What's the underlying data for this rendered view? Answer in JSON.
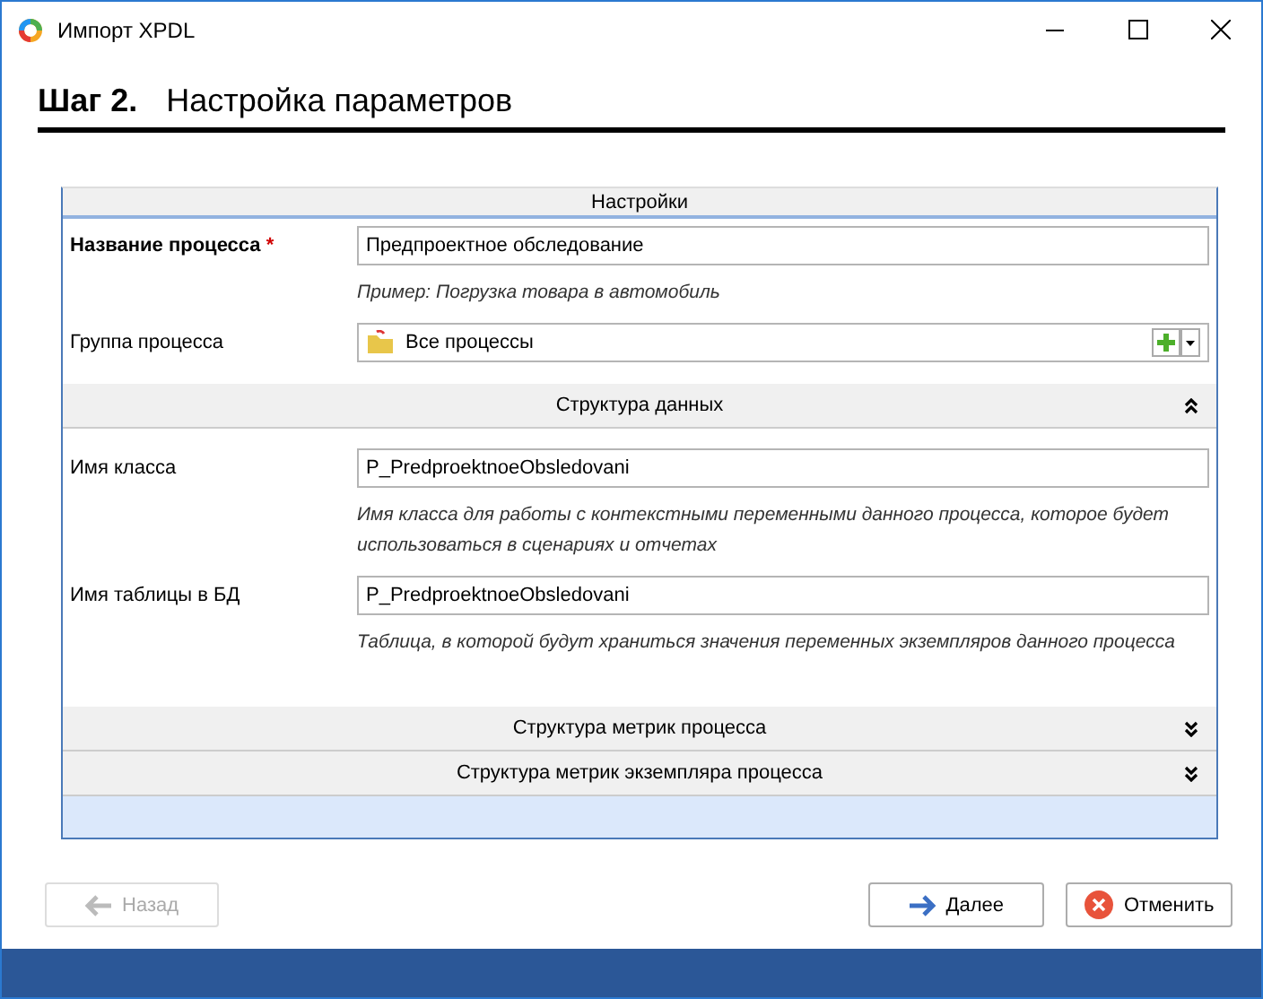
{
  "window": {
    "title": "Импорт XPDL"
  },
  "step": {
    "number": "Шаг 2.",
    "title": "Настройка параметров"
  },
  "panel": {
    "title": "Настройки",
    "fields": [
      {
        "kind": "text",
        "label": "Название процесса",
        "required": true,
        "required_mark": "*",
        "value": "Предпроектное обследование",
        "hint": "Пример: Погрузка товара в автомобиль"
      },
      {
        "kind": "combo",
        "label": "Группа процесса",
        "required": false,
        "value": "Все процессы"
      }
    ],
    "sections": [
      {
        "title": "Структура данных",
        "expanded": true,
        "fields": [
          {
            "kind": "text",
            "label": "Имя класса",
            "required": false,
            "value": "P_PredproektnoeObsledovani",
            "hint": "Имя класса для работы с контекстными переменными данного процесса, которое будет использоваться в сценариях и отчетах"
          },
          {
            "kind": "text",
            "label": "Имя таблицы в БД",
            "required": false,
            "value": "P_PredproektnoeObsledovani",
            "hint": "Таблица, в которой будут храниться значения переменных экземпляров данного процесса"
          }
        ]
      },
      {
        "title": "Структура метрик процесса",
        "expanded": false
      },
      {
        "title": "Структура метрик экземпляра процесса",
        "expanded": false
      }
    ]
  },
  "buttons": [
    {
      "kind": "back",
      "label": "Назад",
      "disabled": true
    },
    {
      "kind": "next",
      "label": "Далее",
      "disabled": false
    },
    {
      "kind": "cancel",
      "label": "Отменить",
      "disabled": false
    }
  ]
}
